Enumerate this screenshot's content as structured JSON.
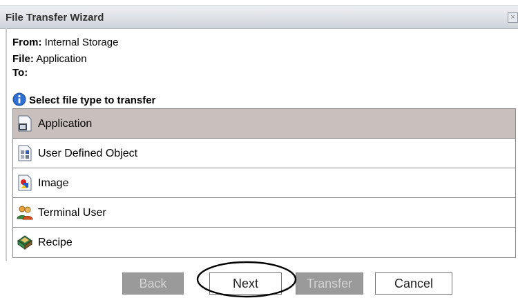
{
  "window": {
    "title": "File Transfer Wizard",
    "close_glyph": "×"
  },
  "info": {
    "from_label": "From:",
    "from_value": "Internal Storage",
    "file_label": "File:",
    "file_value": "Application",
    "to_label": "To:",
    "to_value": ""
  },
  "select_heading": "Select file type to transfer",
  "file_types": [
    {
      "label": "Application",
      "icon": "application-icon",
      "selected": true
    },
    {
      "label": "User Defined Object",
      "icon": "user-defined-object-icon",
      "selected": false
    },
    {
      "label": "Image",
      "icon": "image-icon",
      "selected": false
    },
    {
      "label": "Terminal User",
      "icon": "terminal-user-icon",
      "selected": false
    },
    {
      "label": "Recipe",
      "icon": "recipe-icon",
      "selected": false
    }
  ],
  "buttons": {
    "back": "Back",
    "next": "Next",
    "transfer": "Transfer",
    "cancel": "Cancel"
  },
  "colors": {
    "selected_row": "#c9c0be",
    "disabled_button": "#9a9a9a"
  }
}
